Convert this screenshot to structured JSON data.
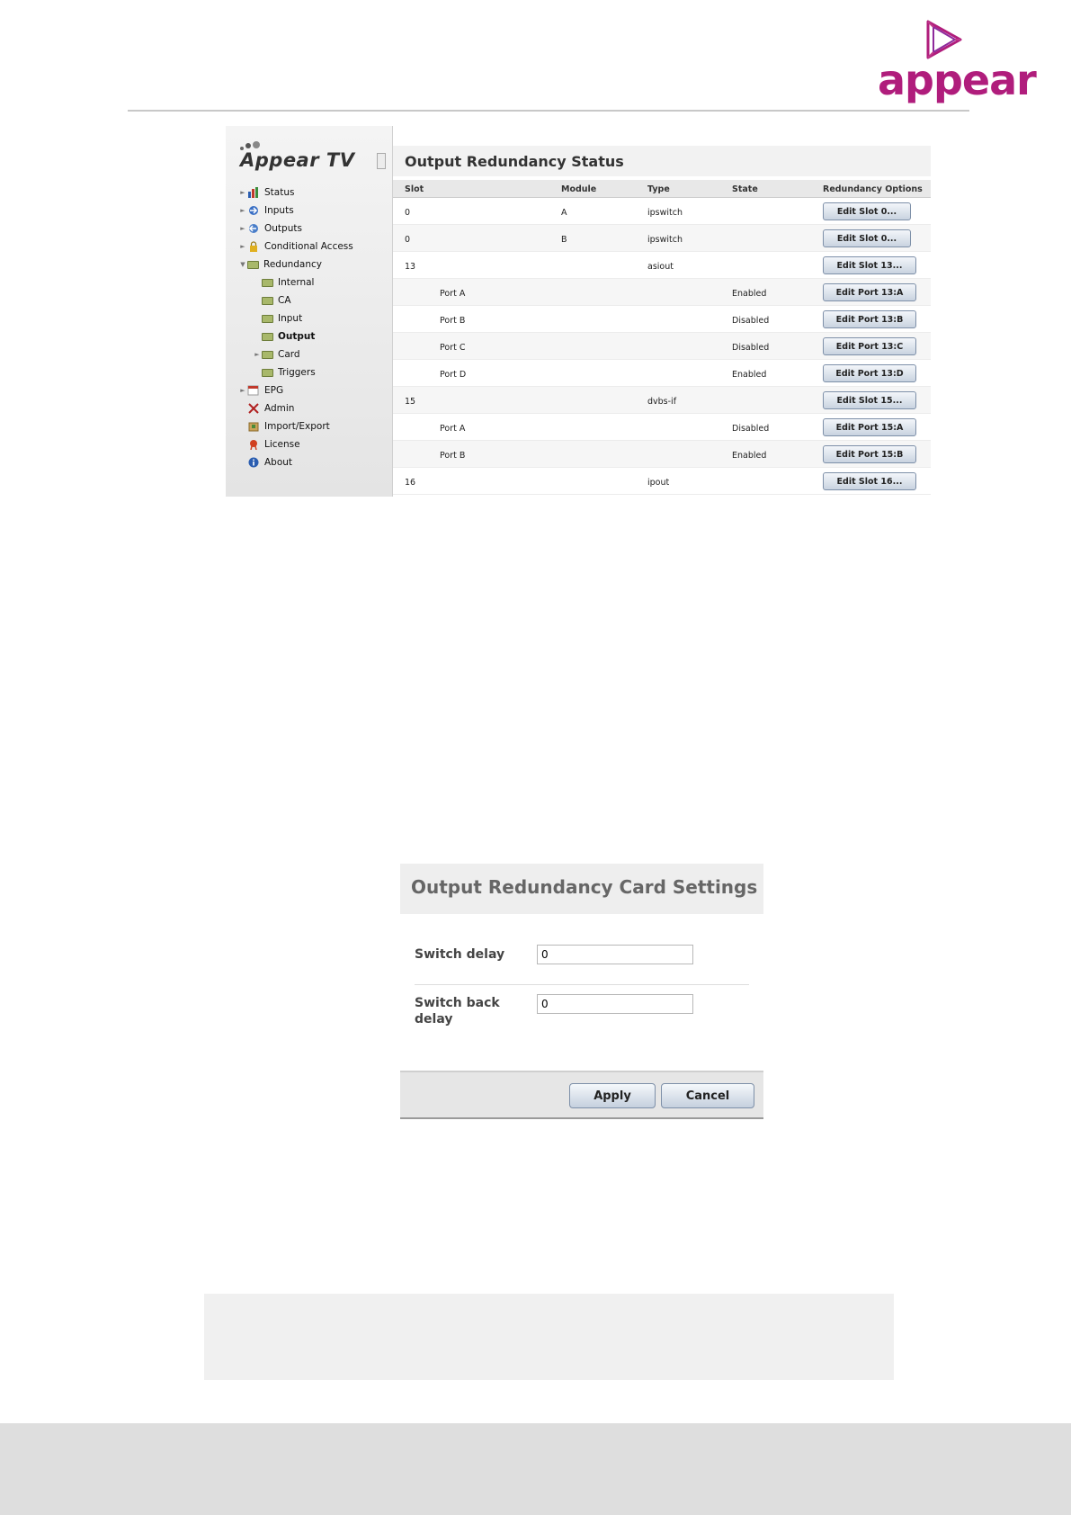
{
  "brand": {
    "wordmark": "appear",
    "color": "#b01d7c"
  },
  "sidebar": {
    "logo_text": "Appear TV",
    "items": [
      {
        "label": "Status",
        "icon": "bar-chart-icon",
        "arrow": "►"
      },
      {
        "label": "Inputs",
        "icon": "input-arrow-icon",
        "arrow": "►"
      },
      {
        "label": "Outputs",
        "icon": "output-arrow-icon",
        "arrow": "►"
      },
      {
        "label": "Conditional Access",
        "icon": "lock-icon",
        "arrow": "►"
      },
      {
        "label": "Redundancy",
        "icon": "folder-icon",
        "arrow": "▼"
      },
      {
        "label": "Internal",
        "icon": "folder-icon",
        "arrow": ""
      },
      {
        "label": "CA",
        "icon": "folder-icon",
        "arrow": ""
      },
      {
        "label": "Input",
        "icon": "folder-icon",
        "arrow": ""
      },
      {
        "label": "Output",
        "icon": "folder-icon",
        "arrow": ""
      },
      {
        "label": "Card",
        "icon": "folder-icon",
        "arrow": "►"
      },
      {
        "label": "Triggers",
        "icon": "folder-icon",
        "arrow": ""
      },
      {
        "label": "EPG",
        "icon": "calendar-icon",
        "arrow": "►"
      },
      {
        "label": "Admin",
        "icon": "tools-icon",
        "arrow": ""
      },
      {
        "label": "Import/Export",
        "icon": "package-icon",
        "arrow": ""
      },
      {
        "label": "License",
        "icon": "certificate-icon",
        "arrow": ""
      },
      {
        "label": "About",
        "icon": "info-icon",
        "arrow": ""
      }
    ]
  },
  "status": {
    "title": "Output Redundancy Status",
    "columns": [
      "Slot",
      "Module",
      "Type",
      "State",
      "Redundancy Options"
    ],
    "rows": [
      {
        "slot": "0",
        "module": "A",
        "type": "ipswitch",
        "port": "",
        "state": "",
        "button": "Edit Slot 0..."
      },
      {
        "slot": "0",
        "module": "B",
        "type": "ipswitch",
        "port": "",
        "state": "",
        "button": "Edit Slot 0..."
      },
      {
        "slot": "13",
        "module": "",
        "type": "asiout",
        "port": "",
        "state": "",
        "button": "Edit Slot 13..."
      },
      {
        "slot": "",
        "module": "",
        "type": "",
        "port": "Port A",
        "state": "Enabled",
        "button": "Edit Port 13:A"
      },
      {
        "slot": "",
        "module": "",
        "type": "",
        "port": "Port B",
        "state": "Disabled",
        "button": "Edit Port 13:B"
      },
      {
        "slot": "",
        "module": "",
        "type": "",
        "port": "Port C",
        "state": "Disabled",
        "button": "Edit Port 13:C"
      },
      {
        "slot": "",
        "module": "",
        "type": "",
        "port": "Port D",
        "state": "Enabled",
        "button": "Edit Port 13:D"
      },
      {
        "slot": "15",
        "module": "",
        "type": "dvbs-if",
        "port": "",
        "state": "",
        "button": "Edit Slot 15..."
      },
      {
        "slot": "",
        "module": "",
        "type": "",
        "port": "Port A",
        "state": "Disabled",
        "button": "Edit Port 15:A"
      },
      {
        "slot": "",
        "module": "",
        "type": "",
        "port": "Port B",
        "state": "Enabled",
        "button": "Edit Port 15:B"
      },
      {
        "slot": "16",
        "module": "",
        "type": "ipout",
        "port": "",
        "state": "",
        "button": "Edit Slot 16..."
      }
    ]
  },
  "card_settings": {
    "title": "Output Redundancy Card Settings",
    "switch_delay_label": "Switch delay",
    "switch_delay_value": "0",
    "switch_back_delay_label": "Switch back delay",
    "switch_back_delay_value": "0",
    "apply_label": "Apply",
    "cancel_label": "Cancel"
  }
}
